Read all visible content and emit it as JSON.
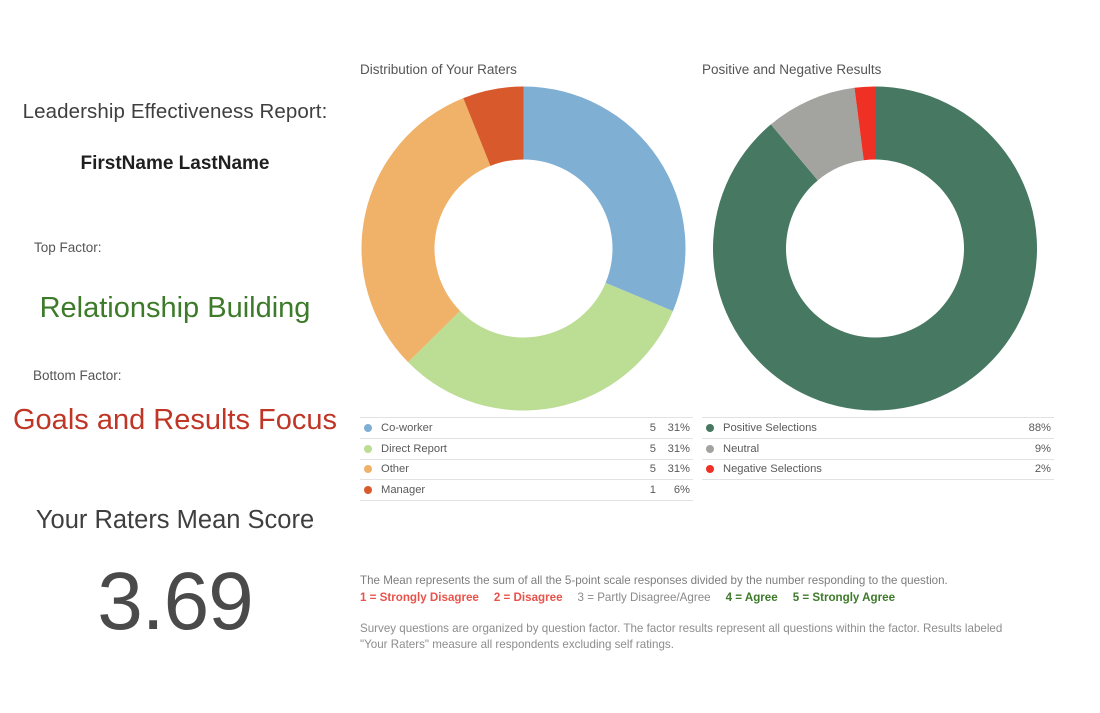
{
  "report": {
    "title": "Leadership Effectiveness Report:",
    "person_name": "FirstName LastName",
    "top_factor_label": "Top Factor:",
    "top_factor_value": "Relationship Building",
    "bottom_factor_label": "Bottom Factor:",
    "bottom_factor_value": "Goals and Results Focus",
    "mean_score_label": "Your Raters Mean Score",
    "mean_score_value": "3.69",
    "top_factor_color": "#3d7a2a",
    "bottom_factor_color": "#bf3526"
  },
  "footnotes": {
    "mean_note": "The Mean represents the sum of all the 5-point scale responses divided by the number responding to the question.",
    "scale": [
      {
        "text": "1 = Strongly Disagree",
        "tone": "negative",
        "color": "#e8534a"
      },
      {
        "text": "2 = Disagree",
        "tone": "negative",
        "color": "#e8534a"
      },
      {
        "text": "3 = Partly Disagree/Agree",
        "tone": "neutral",
        "color": "#8a8a8a"
      },
      {
        "text": "4 = Agree",
        "tone": "positive",
        "color": "#3d7a2a"
      },
      {
        "text": "5 = Strongly Agree",
        "tone": "positive",
        "color": "#3d7a2a"
      }
    ],
    "survey_note": "Survey questions are organized by question factor. The factor results represent all questions within the factor. Results labeled \"Your Raters\"  measure all respondents excluding self ratings."
  },
  "chart_data": [
    {
      "type": "pie",
      "variant": "donut",
      "title": "Distribution of Your Raters",
      "categories": [
        "Co-worker",
        "Direct Report",
        "Other",
        "Manager"
      ],
      "values": [
        5,
        5,
        5,
        1
      ],
      "percents": [
        "31%",
        "31%",
        "31%",
        "6%"
      ],
      "percent_values": [
        31,
        31,
        31,
        6
      ],
      "colors": [
        "#80afd4",
        "#bcdd94",
        "#f0b169",
        "#d85a2c"
      ],
      "legend_position": "bottom",
      "legend_columns": [
        "Label",
        "Count",
        "Percent"
      ],
      "start_angle": 0,
      "total": 16
    },
    {
      "type": "pie",
      "variant": "donut",
      "title": "Positive and Negative Results",
      "categories": [
        "Positive Selections",
        "Neutral",
        "Negative Selections"
      ],
      "values": [
        88,
        9,
        2
      ],
      "percents": [
        "88%",
        "9%",
        "2%"
      ],
      "percent_values": [
        88,
        9,
        2
      ],
      "colors": [
        "#467862",
        "#a3a49f",
        "#ee3124"
      ],
      "legend_position": "bottom",
      "legend_columns": [
        "Label",
        "Percent"
      ],
      "start_angle": 0,
      "total": 99
    }
  ]
}
